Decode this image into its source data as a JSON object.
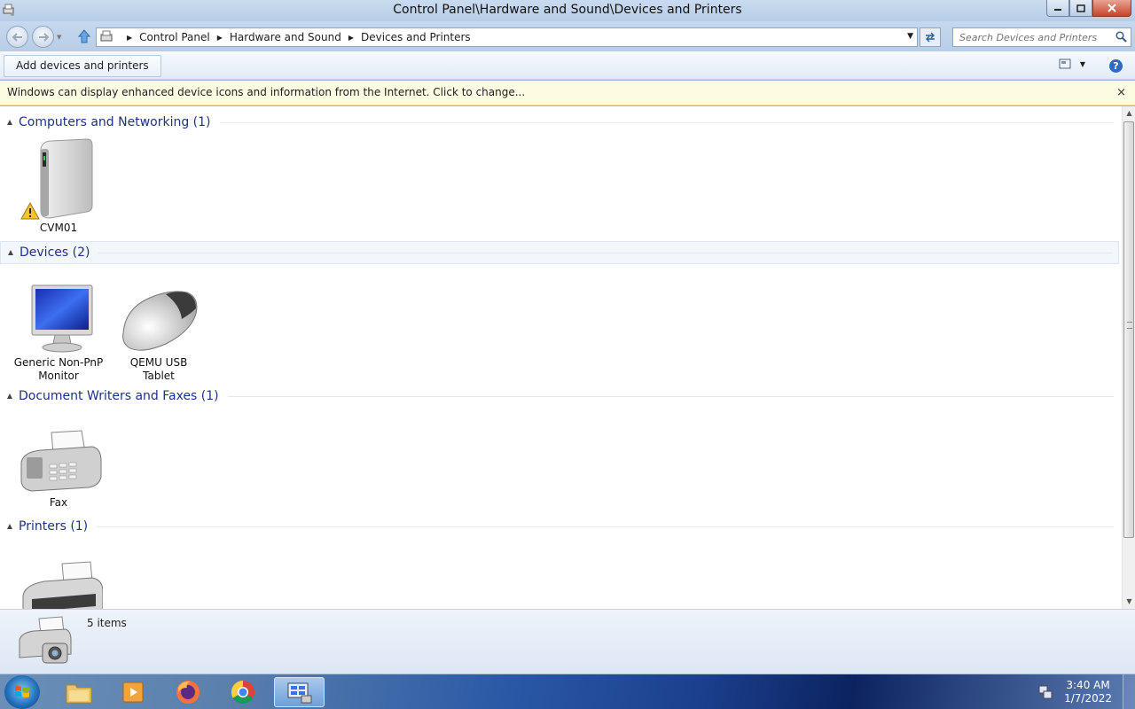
{
  "window": {
    "title": "Control Panel\\Hardware and Sound\\Devices and Printers"
  },
  "address_bar": {
    "crumbs": [
      "Control Panel",
      "Hardware and Sound",
      "Devices and Printers"
    ]
  },
  "search": {
    "placeholder": "Search Devices and Printers"
  },
  "command_bar": {
    "add_label": "Add devices and printers"
  },
  "info_bar": {
    "text": "Windows can display enhanced device icons and information from the Internet. Click to change...",
    "close": "×"
  },
  "groups": [
    {
      "title": "Computers and Networking (1)",
      "items": [
        {
          "label_line1": "CVM01",
          "label_line2": "",
          "icon": "computer-icon",
          "warning": true
        }
      ]
    },
    {
      "title": "Devices (2)",
      "items": [
        {
          "label_line1": "Generic Non-PnP",
          "label_line2": "Monitor",
          "icon": "monitor-icon"
        },
        {
          "label_line1": "QEMU USB",
          "label_line2": "Tablet",
          "icon": "mouse-icon"
        }
      ]
    },
    {
      "title": "Document Writers and Faxes (1)",
      "items": [
        {
          "label_line1": "Fax",
          "label_line2": "",
          "icon": "fax-icon"
        }
      ]
    },
    {
      "title": "Printers (1)",
      "items": [
        {
          "label_line1": "",
          "label_line2": "",
          "icon": "printer-icon"
        }
      ]
    }
  ],
  "details_pane": {
    "count": "5 items"
  },
  "taskbar": {
    "apps": [
      "file-explorer-icon",
      "media-player-icon",
      "firefox-icon",
      "chrome-icon",
      "devices-and-printers-icon"
    ],
    "time": "3:40 AM",
    "date": "1/7/2022"
  },
  "colors": {
    "group_title": "#1e3287",
    "info_bar_bg": "#fdfbe1",
    "chrome_blue": "#b8cde7"
  }
}
